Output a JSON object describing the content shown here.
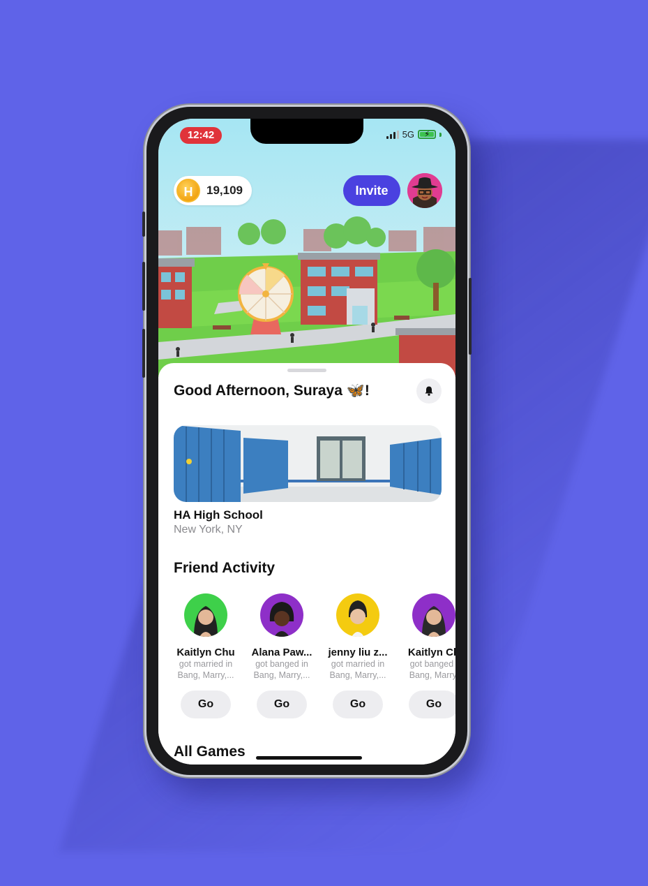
{
  "status_bar": {
    "time": "12:42",
    "network": "5G"
  },
  "header": {
    "coins": "19,109",
    "coin_symbol": "H",
    "invite_label": "Invite"
  },
  "greeting": "Good Afternoon, Suraya 🦋!",
  "school": {
    "name": "HA High School",
    "location": "New York, NY"
  },
  "friend_activity": {
    "title": "Friend Activity",
    "items": [
      {
        "name": "Kaitlyn Chu",
        "action": "got married in",
        "game": "Bang, Marry,...",
        "button": "Go",
        "color": "#3ed04a"
      },
      {
        "name": "Alana Paw...",
        "action": "got banged in",
        "game": "Bang, Marry,...",
        "button": "Go",
        "color": "#8e2fc8"
      },
      {
        "name": "jenny liu z...",
        "action": "got married in",
        "game": "Bang, Marry,...",
        "button": "Go",
        "color": "#f4cb10"
      },
      {
        "name": "Kaitlyn Ch",
        "action": "got banged i",
        "game": "Bang, Marry,",
        "button": "Go",
        "color": "#8e2fc8"
      }
    ]
  },
  "all_games": {
    "title": "All Games"
  },
  "colors": {
    "background": "#5f63e8",
    "accent": "#4a41e0",
    "time_pill": "#e0333a"
  },
  "icons": {
    "bell": "bell-icon",
    "coin": "coin-icon",
    "battery": "battery-charging-icon"
  }
}
